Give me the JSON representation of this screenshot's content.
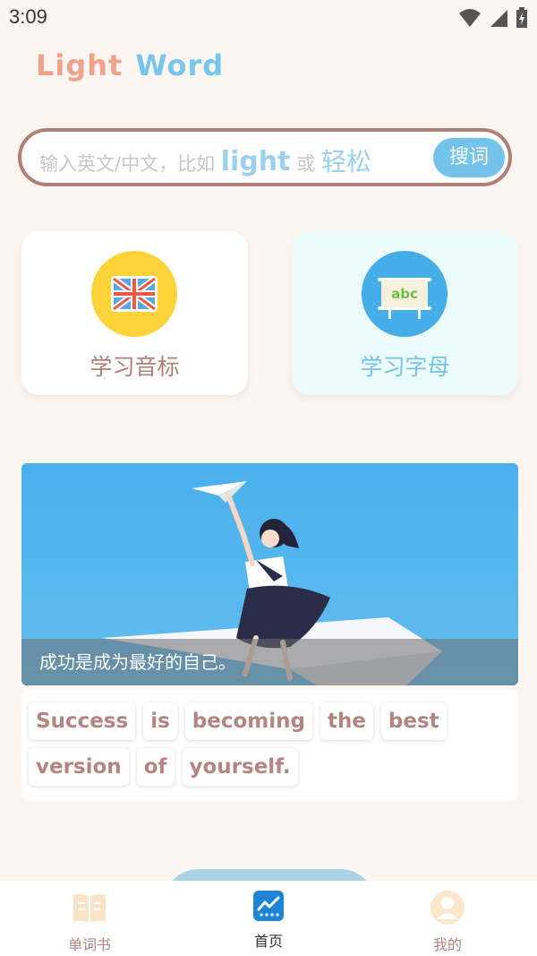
{
  "status": {
    "time": "3:09"
  },
  "app": {
    "title_part1": "Light",
    "title_part2": "Word"
  },
  "search": {
    "placeholder_prefix": "输入英文/中文，比如",
    "example_en": "light",
    "or_word": "或",
    "example_cn": "轻松",
    "button_label": "搜词"
  },
  "cards": [
    {
      "label": "学习音标",
      "icon": "uk-flag-icon"
    },
    {
      "label": "学习字母",
      "icon": "abc-board-icon"
    }
  ],
  "banner": {
    "caption": "成功是成为最好的自己。"
  },
  "quote_words": [
    "Success",
    "is",
    "becoming",
    "the",
    "best",
    "version",
    "of",
    "yourself."
  ],
  "tabs": [
    {
      "label": "单词书",
      "icon": "book-icon"
    },
    {
      "label": "首页",
      "icon": "home-chart-icon"
    },
    {
      "label": "我的",
      "icon": "user-icon"
    }
  ],
  "colors": {
    "background": "#fdf6f0",
    "accent_blue": "#74c3ea",
    "accent_brown": "#b07f78",
    "title_pink": "#f2a28c"
  }
}
